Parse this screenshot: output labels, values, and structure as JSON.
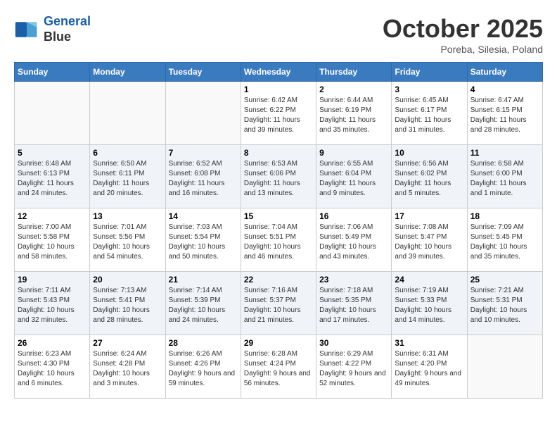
{
  "header": {
    "logo_line1": "General",
    "logo_line2": "Blue",
    "month": "October 2025",
    "location": "Poreba, Silesia, Poland"
  },
  "days_of_week": [
    "Sunday",
    "Monday",
    "Tuesday",
    "Wednesday",
    "Thursday",
    "Friday",
    "Saturday"
  ],
  "weeks": [
    [
      {
        "day": "",
        "info": ""
      },
      {
        "day": "",
        "info": ""
      },
      {
        "day": "",
        "info": ""
      },
      {
        "day": "1",
        "info": "Sunrise: 6:42 AM\nSunset: 6:22 PM\nDaylight: 11 hours and 39 minutes."
      },
      {
        "day": "2",
        "info": "Sunrise: 6:44 AM\nSunset: 6:19 PM\nDaylight: 11 hours and 35 minutes."
      },
      {
        "day": "3",
        "info": "Sunrise: 6:45 AM\nSunset: 6:17 PM\nDaylight: 11 hours and 31 minutes."
      },
      {
        "day": "4",
        "info": "Sunrise: 6:47 AM\nSunset: 6:15 PM\nDaylight: 11 hours and 28 minutes."
      }
    ],
    [
      {
        "day": "5",
        "info": "Sunrise: 6:48 AM\nSunset: 6:13 PM\nDaylight: 11 hours and 24 minutes."
      },
      {
        "day": "6",
        "info": "Sunrise: 6:50 AM\nSunset: 6:11 PM\nDaylight: 11 hours and 20 minutes."
      },
      {
        "day": "7",
        "info": "Sunrise: 6:52 AM\nSunset: 6:08 PM\nDaylight: 11 hours and 16 minutes."
      },
      {
        "day": "8",
        "info": "Sunrise: 6:53 AM\nSunset: 6:06 PM\nDaylight: 11 hours and 13 minutes."
      },
      {
        "day": "9",
        "info": "Sunrise: 6:55 AM\nSunset: 6:04 PM\nDaylight: 11 hours and 9 minutes."
      },
      {
        "day": "10",
        "info": "Sunrise: 6:56 AM\nSunset: 6:02 PM\nDaylight: 11 hours and 5 minutes."
      },
      {
        "day": "11",
        "info": "Sunrise: 6:58 AM\nSunset: 6:00 PM\nDaylight: 11 hours and 1 minute."
      }
    ],
    [
      {
        "day": "12",
        "info": "Sunrise: 7:00 AM\nSunset: 5:58 PM\nDaylight: 10 hours and 58 minutes."
      },
      {
        "day": "13",
        "info": "Sunrise: 7:01 AM\nSunset: 5:56 PM\nDaylight: 10 hours and 54 minutes."
      },
      {
        "day": "14",
        "info": "Sunrise: 7:03 AM\nSunset: 5:54 PM\nDaylight: 10 hours and 50 minutes."
      },
      {
        "day": "15",
        "info": "Sunrise: 7:04 AM\nSunset: 5:51 PM\nDaylight: 10 hours and 46 minutes."
      },
      {
        "day": "16",
        "info": "Sunrise: 7:06 AM\nSunset: 5:49 PM\nDaylight: 10 hours and 43 minutes."
      },
      {
        "day": "17",
        "info": "Sunrise: 7:08 AM\nSunset: 5:47 PM\nDaylight: 10 hours and 39 minutes."
      },
      {
        "day": "18",
        "info": "Sunrise: 7:09 AM\nSunset: 5:45 PM\nDaylight: 10 hours and 35 minutes."
      }
    ],
    [
      {
        "day": "19",
        "info": "Sunrise: 7:11 AM\nSunset: 5:43 PM\nDaylight: 10 hours and 32 minutes."
      },
      {
        "day": "20",
        "info": "Sunrise: 7:13 AM\nSunset: 5:41 PM\nDaylight: 10 hours and 28 minutes."
      },
      {
        "day": "21",
        "info": "Sunrise: 7:14 AM\nSunset: 5:39 PM\nDaylight: 10 hours and 24 minutes."
      },
      {
        "day": "22",
        "info": "Sunrise: 7:16 AM\nSunset: 5:37 PM\nDaylight: 10 hours and 21 minutes."
      },
      {
        "day": "23",
        "info": "Sunrise: 7:18 AM\nSunset: 5:35 PM\nDaylight: 10 hours and 17 minutes."
      },
      {
        "day": "24",
        "info": "Sunrise: 7:19 AM\nSunset: 5:33 PM\nDaylight: 10 hours and 14 minutes."
      },
      {
        "day": "25",
        "info": "Sunrise: 7:21 AM\nSunset: 5:31 PM\nDaylight: 10 hours and 10 minutes."
      }
    ],
    [
      {
        "day": "26",
        "info": "Sunrise: 6:23 AM\nSunset: 4:30 PM\nDaylight: 10 hours and 6 minutes."
      },
      {
        "day": "27",
        "info": "Sunrise: 6:24 AM\nSunset: 4:28 PM\nDaylight: 10 hours and 3 minutes."
      },
      {
        "day": "28",
        "info": "Sunrise: 6:26 AM\nSunset: 4:26 PM\nDaylight: 9 hours and 59 minutes."
      },
      {
        "day": "29",
        "info": "Sunrise: 6:28 AM\nSunset: 4:24 PM\nDaylight: 9 hours and 56 minutes."
      },
      {
        "day": "30",
        "info": "Sunrise: 6:29 AM\nSunset: 4:22 PM\nDaylight: 9 hours and 52 minutes."
      },
      {
        "day": "31",
        "info": "Sunrise: 6:31 AM\nSunset: 4:20 PM\nDaylight: 9 hours and 49 minutes."
      },
      {
        "day": "",
        "info": ""
      }
    ]
  ]
}
